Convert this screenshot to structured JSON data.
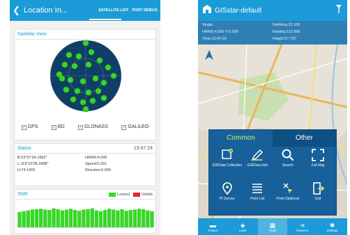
{
  "left_app": {
    "header": {
      "title": "Location In...",
      "tab_satellite": "SATELLITE LIST",
      "tab_port": "PORT DEBUG"
    },
    "satellite_view": {
      "title": "Satellite View"
    },
    "constellations": [
      "GPS",
      "BD",
      "GLONASS",
      "GALILEO"
    ],
    "status": {
      "title": "Status",
      "time": "13:47:24",
      "b": "B:23°07'34.1962\"",
      "hrms": "HRMS:4.000",
      "l": "L:113°22'06.2488\"",
      "speed": "Speed:0.291",
      "h": "H:74.1665",
      "direction": "Direction:0.000"
    },
    "snr": {
      "title": "SNR",
      "legend_locked": "Locked",
      "legend_visible": "Visible",
      "values": [
        38,
        40,
        42,
        44,
        45,
        46,
        44,
        43,
        47,
        45,
        42,
        44,
        46,
        43,
        41,
        44,
        45,
        47,
        42,
        40,
        43,
        46,
        44,
        42,
        45,
        41,
        43,
        44,
        46,
        45,
        42,
        40
      ]
    },
    "colors": {
      "accent": "#1b9bd7",
      "sky": "#0f3f66",
      "satellite": "#39d62a",
      "locked": "#39d62a",
      "visible": "#e2282b"
    }
  },
  "right_app": {
    "header": {
      "title": "GISstar-default"
    },
    "info": {
      "single": "Single",
      "northing": "Northing:23.109",
      "hrms": "HRMS:4.000 V:0.000",
      "easting": "Easting:113.368",
      "time": "Time:13:47:22",
      "height": "Height:37.737"
    },
    "menu": {
      "tab_common": "Common",
      "tab_other": "Other",
      "items": [
        {
          "label": "GISData Collection",
          "icon": "add-point-icon"
        },
        {
          "label": "GISData Edit",
          "icon": "edit-pencil-icon"
        },
        {
          "label": "Search",
          "icon": "search-icon"
        },
        {
          "label": "Full Map",
          "icon": "full-map-icon"
        },
        {
          "label": "Pt Survey",
          "icon": "location-pin-icon"
        },
        {
          "label": "Point List",
          "icon": "list-icon"
        },
        {
          "label": "Point Stakeout",
          "icon": "stakeout-icon"
        },
        {
          "label": "Exit",
          "icon": "exit-icon"
        }
      ]
    },
    "bottom_nav": [
      "Project",
      "Layer",
      "Tools",
      "Features",
      "Settings"
    ],
    "colors": {
      "accent": "#1b9bd7",
      "menu_bg": "#17609a",
      "common_tab": "#d8f06a"
    }
  }
}
